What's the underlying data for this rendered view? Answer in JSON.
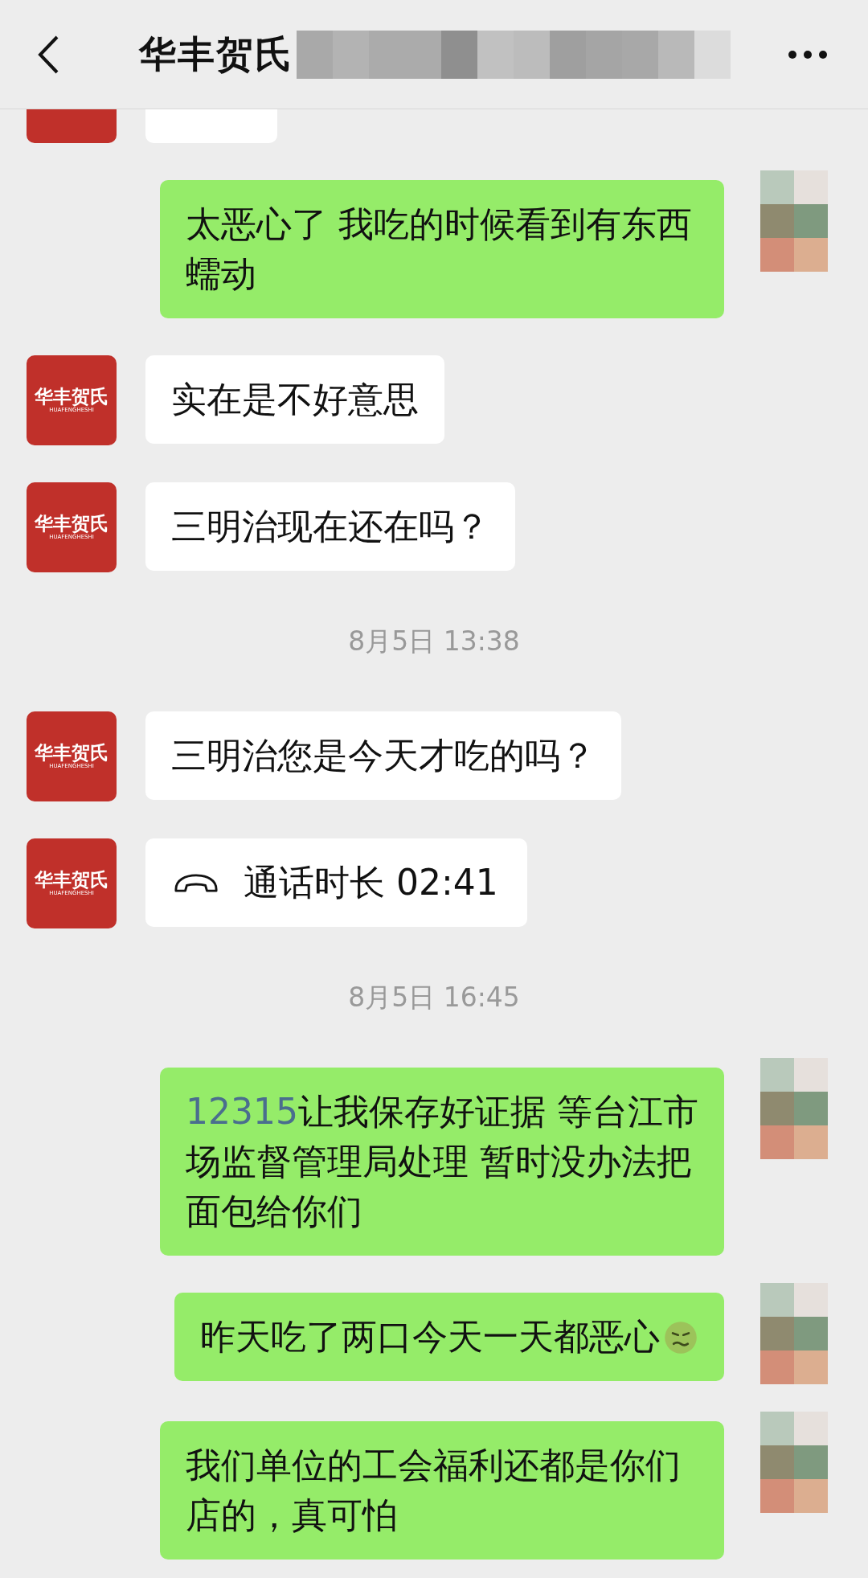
{
  "header": {
    "title": "华丰贺氏"
  },
  "messages": [
    {
      "kind": "in_partial"
    },
    {
      "kind": "out_text",
      "parts": [
        {
          "kind": "text",
          "text": "太恶心了 我吃的时候看到有东西蠕动"
        }
      ]
    },
    {
      "kind": "in_text",
      "avatar": {
        "name": "华丰贺氏",
        "latin": "HUAFENGHESHI"
      },
      "parts": [
        {
          "kind": "text",
          "text": "实在是不好意思"
        }
      ]
    },
    {
      "kind": "in_text",
      "avatar": {
        "name": "华丰贺氏",
        "latin": "HUAFENGHESHI"
      },
      "parts": [
        {
          "kind": "text",
          "text": "三明治现在还在吗？"
        }
      ]
    },
    {
      "kind": "time",
      "text": "8月5日 13:38"
    },
    {
      "kind": "in_text",
      "avatar": {
        "name": "华丰贺氏",
        "latin": "HUAFENGHESHI"
      },
      "parts": [
        {
          "kind": "text",
          "text": "三明治您是今天才吃的吗？"
        }
      ]
    },
    {
      "kind": "in_call",
      "avatar": {
        "name": "华丰贺氏",
        "latin": "HUAFENGHESHI"
      },
      "text": "通话时长 02:41"
    },
    {
      "kind": "time",
      "text": "8月5日 16:45"
    },
    {
      "kind": "out_text",
      "parts": [
        {
          "kind": "link",
          "text": "12315"
        },
        {
          "kind": "text",
          "text": "让我保存好证据 等台江市场监督管理局处理 暂时没办法把面包给你们"
        }
      ]
    },
    {
      "kind": "out_text",
      "parts": [
        {
          "kind": "text",
          "text": "昨天吃了两口今天一天都恶心"
        },
        {
          "kind": "emoji"
        }
      ]
    },
    {
      "kind": "out_text",
      "parts": [
        {
          "kind": "text",
          "text": "我们单位的工会福利还都是你们店的，真可怕"
        }
      ]
    }
  ]
}
